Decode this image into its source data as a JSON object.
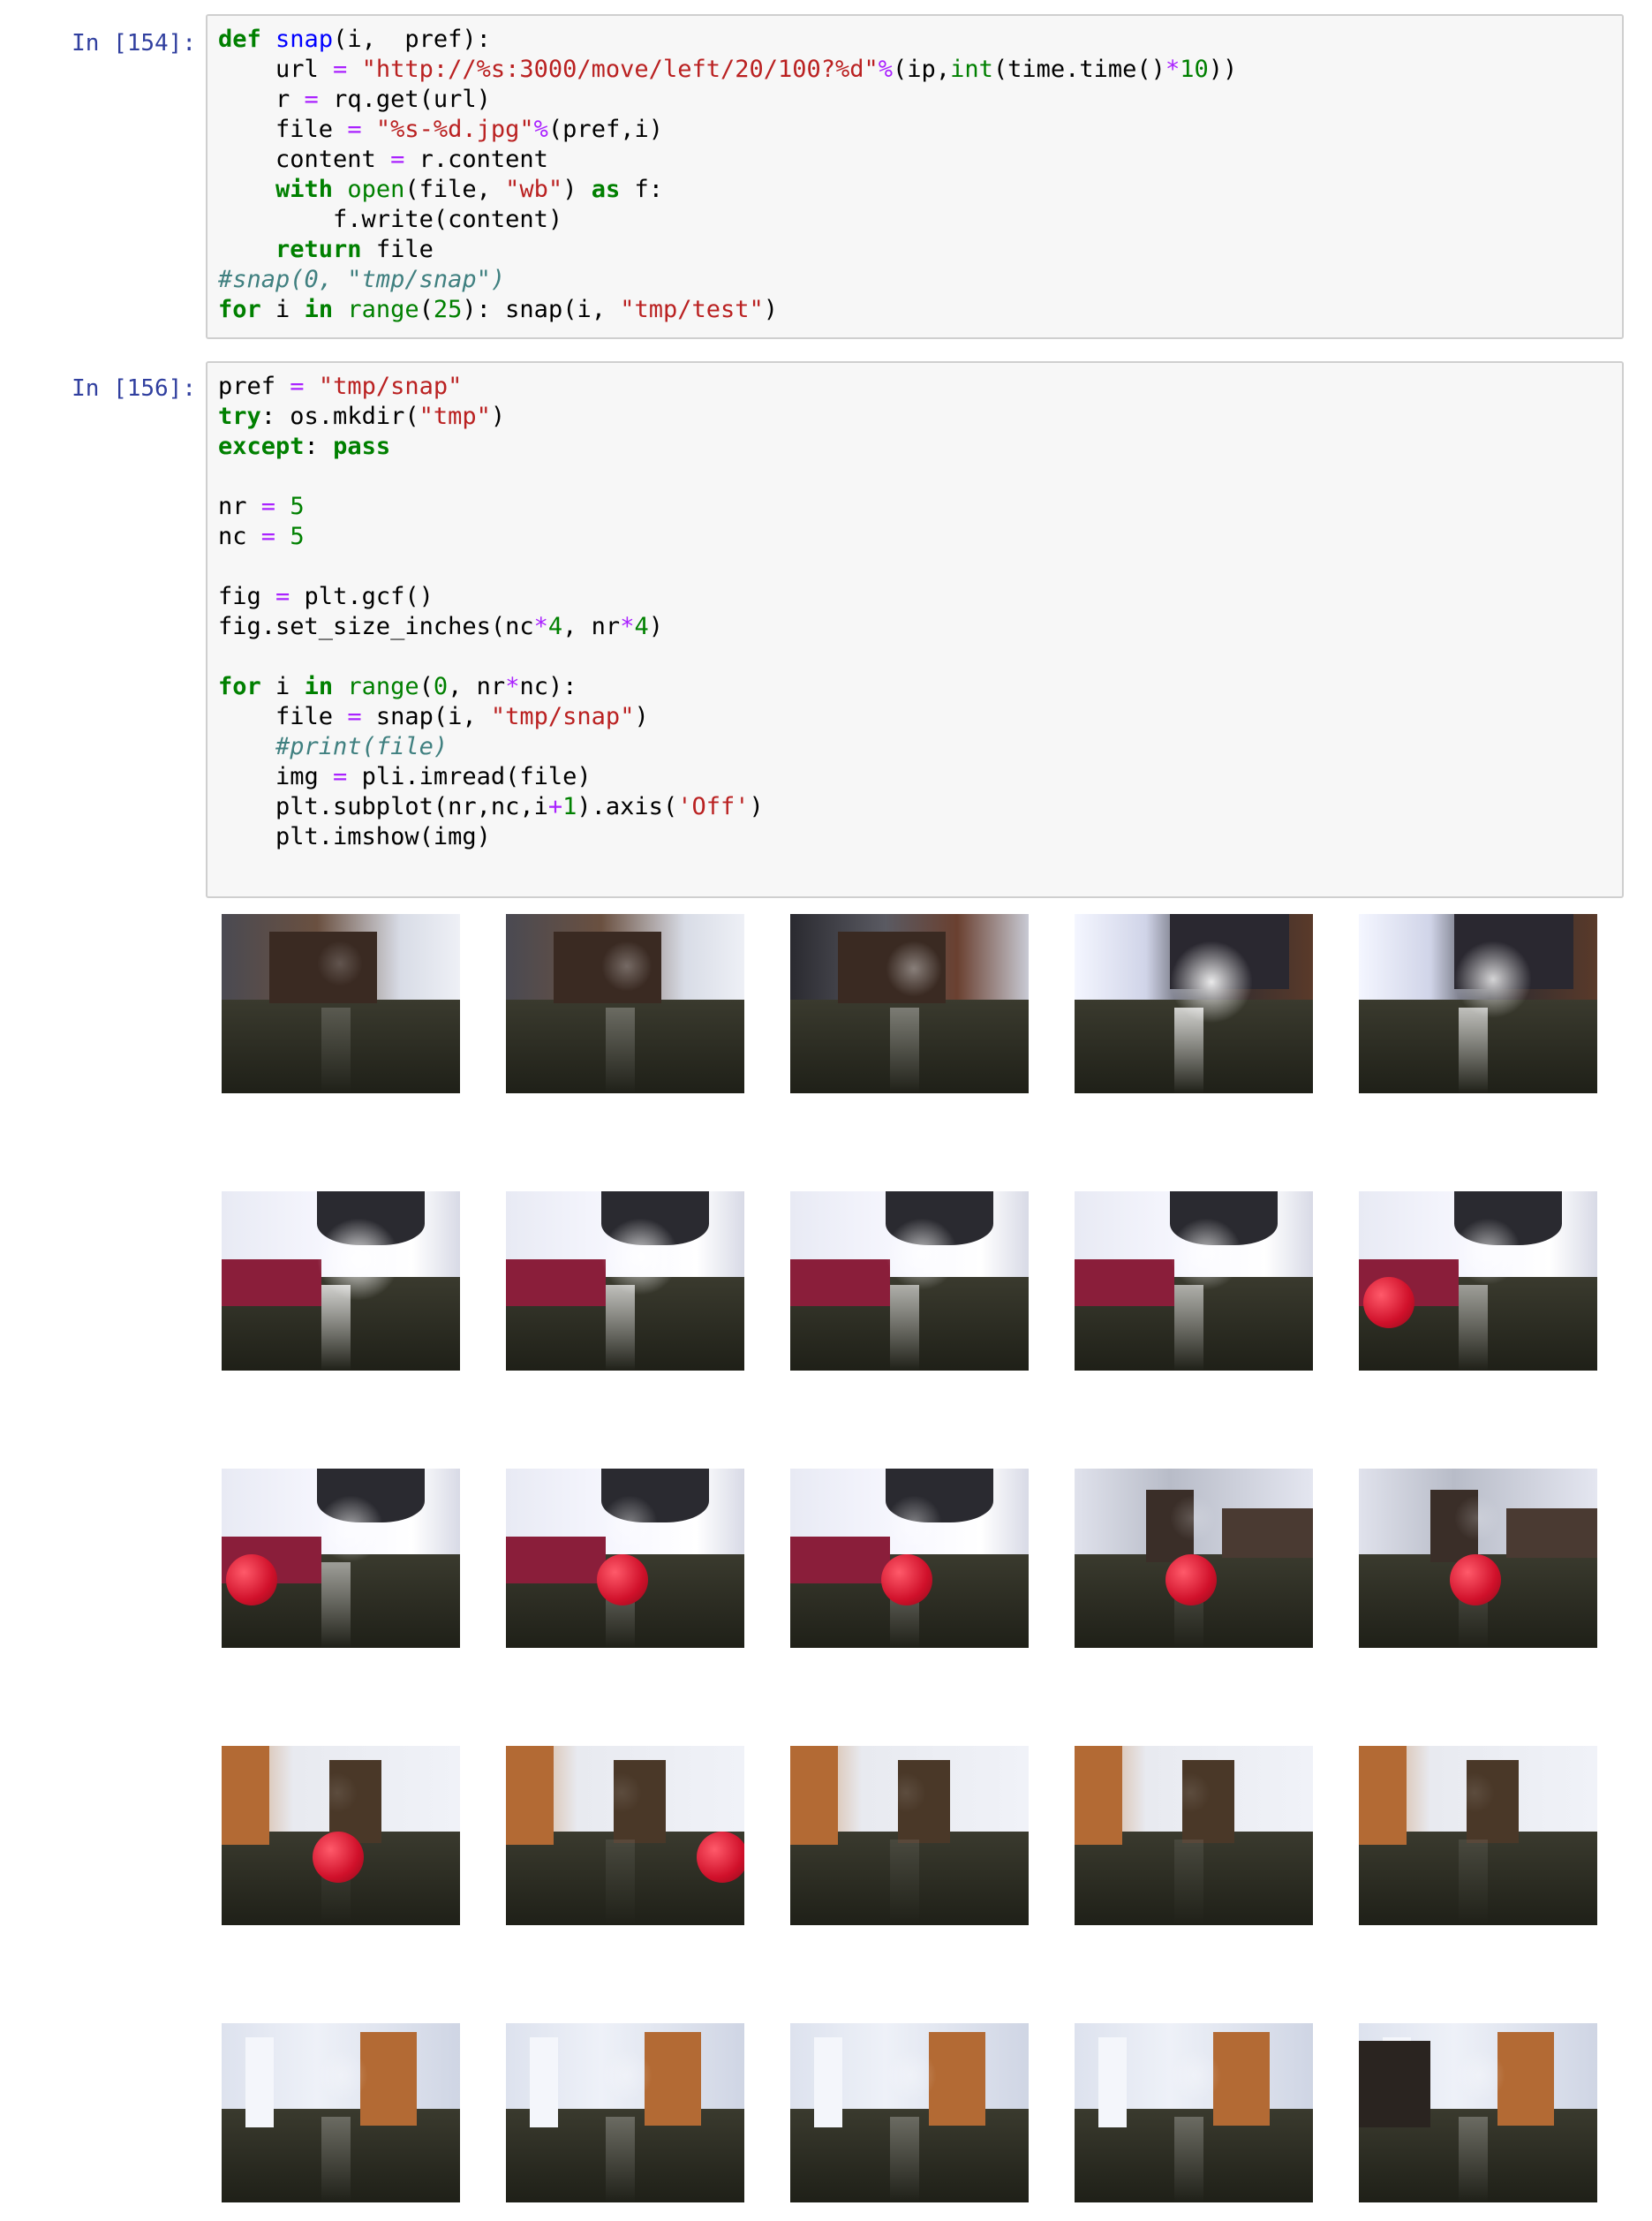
{
  "cells": [
    {
      "prompt": "In [154]:",
      "lines": [
        "def snap(i,  pref):",
        "    url = \"http://%s:3000/move/left/20/100?%d\"%(ip,int(time.time()*10))",
        "    r = rq.get(url)",
        "    file = \"%s-%d.jpg\"%(pref,i)",
        "    content = r.content",
        "    with open(file, \"wb\") as f:",
        "        f.write(content)",
        "    return file",
        "#snap(0, \"tmp/snap\")",
        "for i in range(25): snap(i, \"tmp/test\")"
      ]
    },
    {
      "prompt": "In [156]:",
      "lines": [
        "pref = \"tmp/snap\"",
        "try: os.mkdir(\"tmp\")",
        "except: pass",
        "",
        "nr = 5",
        "nc = 5",
        "",
        "fig = plt.gcf()",
        "fig.set_size_inches(nc*4, nr*4)",
        "",
        "for i in range(0, nr*nc):",
        "    file = snap(i, \"tmp/snap\")",
        "    #print(file)",
        "    img = pli.imread(file)",
        "    plt.subplot(nr,nc,i+1).axis('Off')",
        "    plt.imshow(img)",
        ""
      ]
    }
  ],
  "output": {
    "rows": 5,
    "cols": 5,
    "frames": [
      {
        "scene": "dark-room",
        "glare": 0.2,
        "ball": null
      },
      {
        "scene": "dark-room",
        "glare": 0.3,
        "ball": null
      },
      {
        "scene": "blur",
        "glare": 0.4,
        "ball": null
      },
      {
        "scene": "bright",
        "glare": 0.9,
        "ball": null
      },
      {
        "scene": "bright",
        "glare": 0.8,
        "ball": null
      },
      {
        "scene": "couch",
        "glare": 0.9,
        "ball": null
      },
      {
        "scene": "couch",
        "glare": 0.8,
        "ball": null
      },
      {
        "scene": "couch",
        "glare": 0.7,
        "ball": null
      },
      {
        "scene": "couch",
        "glare": 0.7,
        "ball": null
      },
      {
        "scene": "couch",
        "glare": 0.6,
        "ball": "left"
      },
      {
        "scene": "couch",
        "glare": 0.6,
        "ball": "left"
      },
      {
        "scene": "couch",
        "glare": 0.4,
        "ball": "center"
      },
      {
        "scene": "couch",
        "glare": 0.4,
        "ball": "center"
      },
      {
        "scene": "hall",
        "glare": 0.2,
        "ball": "center"
      },
      {
        "scene": "hall",
        "glare": 0.2,
        "ball": "center"
      },
      {
        "scene": "door",
        "glare": 0.1,
        "ball": "center"
      },
      {
        "scene": "door",
        "glare": 0.1,
        "ball": "right"
      },
      {
        "scene": "door",
        "glare": 0.1,
        "ball": null
      },
      {
        "scene": "door",
        "glare": 0.1,
        "ball": null
      },
      {
        "scene": "door",
        "glare": 0.1,
        "ball": null
      },
      {
        "scene": "corridor",
        "glare": 0.3,
        "ball": null
      },
      {
        "scene": "corridor",
        "glare": 0.3,
        "ball": null
      },
      {
        "scene": "corridor",
        "glare": 0.3,
        "ball": null
      },
      {
        "scene": "corridor",
        "glare": 0.3,
        "ball": null
      },
      {
        "scene": "corridor-dark",
        "glare": 0.3,
        "ball": null
      }
    ]
  }
}
